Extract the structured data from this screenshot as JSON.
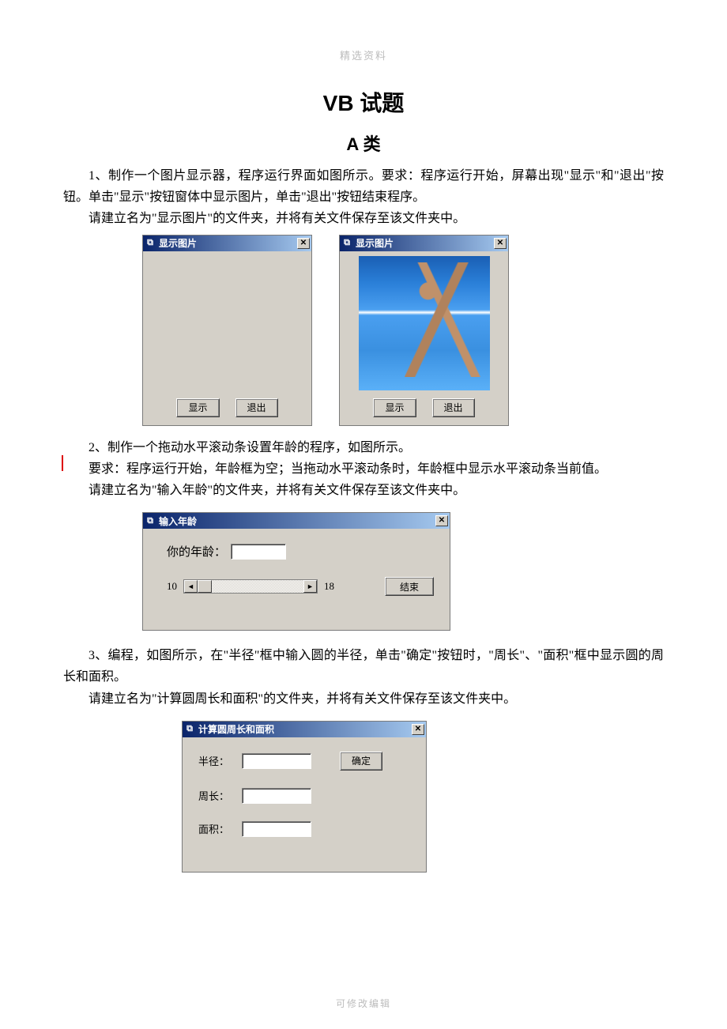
{
  "doc": {
    "header_mark": "精选资料",
    "title_main": "VB 试题",
    "title_sub": "A 类",
    "q1_p1": "1、制作一个图片显示器，程序运行界面如图所示。要求：程序运行开始，屏幕出现\"显示\"和\"退出\"按钮。单击\"显示\"按钮窗体中显示图片，单击\"退出\"按钮结束程序。",
    "q1_p2": "请建立名为\"显示图片\"的文件夹，并将有关文件保存至该文件夹中。",
    "q2_p1": "2、制作一个拖动水平滚动条设置年龄的程序，如图所示。",
    "q2_p2": "要求：程序运行开始，年龄框为空；当拖动水平滚动条时，年龄框中显示水平滚动条当前值。",
    "q2_p3": "请建立名为\"输入年龄\"的文件夹，并将有关文件保存至该文件夹中。",
    "q3_p1": "3、编程，如图所示，在\"半径\"框中输入圆的半径，单击\"确定\"按钮时，\"周长\"、\"面积\"框中显示圆的周长和面积。",
    "q3_p2": "请建立名为\"计算圆周长和面积\"的文件夹，并将有关文件保存至该文件夹中。",
    "footer_mark": "可修改编辑"
  },
  "win1": {
    "title": "显示图片",
    "btn_show": "显示",
    "btn_exit": "退出"
  },
  "win2": {
    "title": "输入年龄",
    "label_age": "你的年龄：",
    "scroll_min": "10",
    "scroll_max": "18",
    "btn_end": "结束"
  },
  "win3": {
    "title": "计算圆周长和面积",
    "label_radius": "半径：",
    "label_perimeter": "周长：",
    "label_area": "面积：",
    "btn_ok": "确定"
  }
}
